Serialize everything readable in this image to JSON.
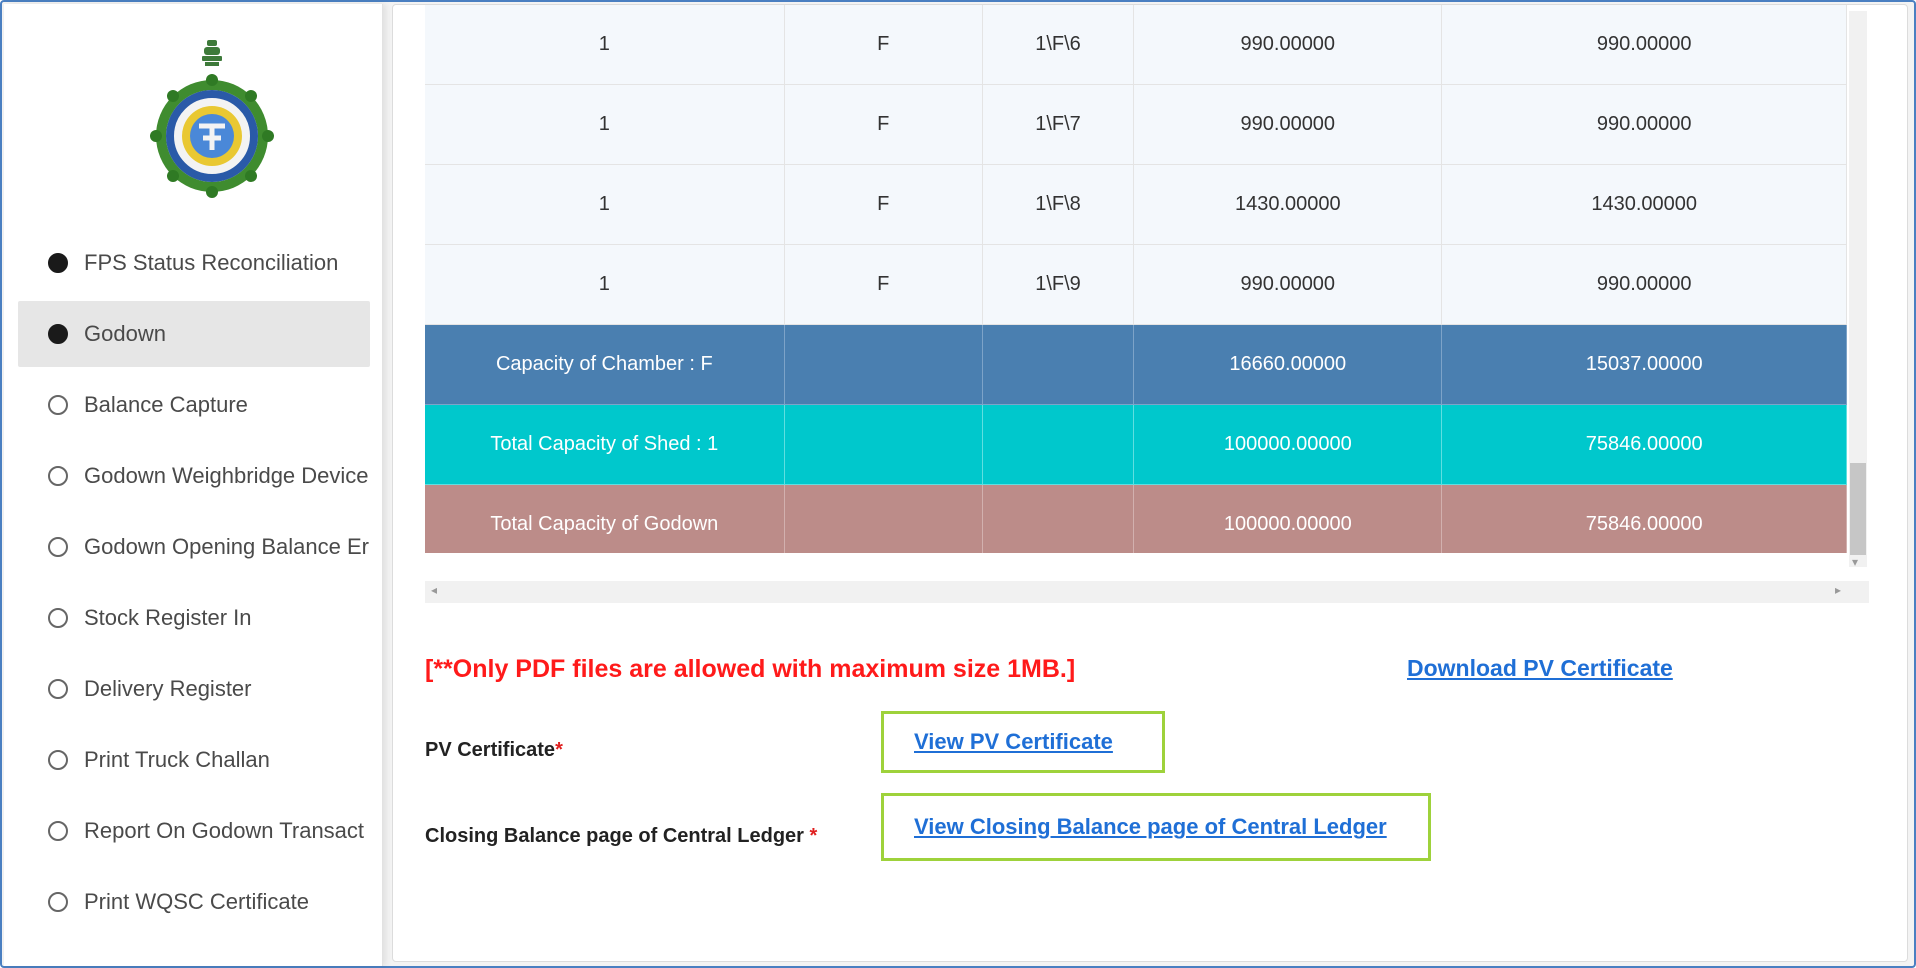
{
  "sidebar": {
    "items": [
      {
        "label": "FPS Status Reconciliation",
        "selected": true
      },
      {
        "label": "Godown",
        "selected": true,
        "active": true
      },
      {
        "label": "Balance Capture",
        "selected": false
      },
      {
        "label": "Godown Weighbridge Device",
        "selected": false
      },
      {
        "label": "Godown Opening Balance Er",
        "selected": false
      },
      {
        "label": "Stock Register In",
        "selected": false
      },
      {
        "label": "Delivery Register",
        "selected": false
      },
      {
        "label": "Print Truck Challan",
        "selected": false
      },
      {
        "label": "Report On Godown Transact",
        "selected": false
      },
      {
        "label": "Print WQSC Certificate",
        "selected": false
      }
    ]
  },
  "table": {
    "rows": [
      [
        "1",
        "F",
        "1\\F\\6",
        "990.00000",
        "990.00000"
      ],
      [
        "1",
        "F",
        "1\\F\\7",
        "990.00000",
        "990.00000"
      ],
      [
        "1",
        "F",
        "1\\F\\8",
        "1430.00000",
        "1430.00000"
      ],
      [
        "1",
        "F",
        "1\\F\\9",
        "990.00000",
        "990.00000"
      ]
    ],
    "chamber": {
      "label": "Capacity of Chamber : F",
      "col4": "16660.00000",
      "col5": "15037.00000"
    },
    "shed": {
      "label": "Total Capacity of Shed : 1",
      "col4": "100000.00000",
      "col5": "75846.00000"
    },
    "godown": {
      "label": "Total Capacity of Godown",
      "col4": "100000.00000",
      "col5": "75846.00000"
    }
  },
  "upload": {
    "note": "[**Only PDF files are allowed with maximum size 1MB.]",
    "download_link": "Download PV Certificate",
    "pv_label": "PV Certificate",
    "pv_link": "View PV Certificate",
    "closing_label": "Closing Balance page of Central Ledger ",
    "closing_link": "View Closing Balance page of Central Ledger",
    "required_mark": "*"
  },
  "colors": {
    "chamber_row": "#4a7fb0",
    "shed_row": "#00c8cc",
    "godown_row": "#bc8c89",
    "note_red": "#ff1a1a",
    "link_blue": "#1f6fd6",
    "highlight_green": "#9ed23b"
  }
}
